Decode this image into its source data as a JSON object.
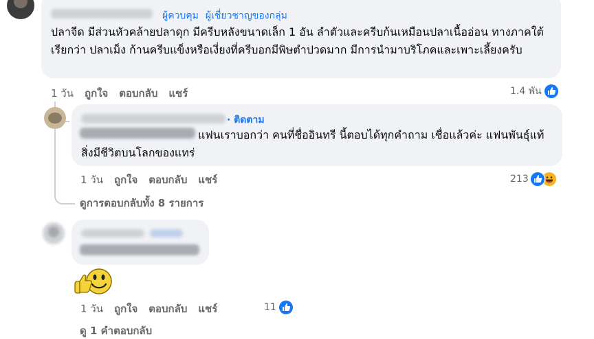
{
  "comment1": {
    "badges": [
      "ผู้ควบคุม",
      "ผู้เชี่ยวชาญของกลุ่ม"
    ],
    "text": "ปลาจีด มีส่วนหัวคล้ายปลาดุก มีครีบหลังขนาดเล็ก 1 อัน ลำตัวและครีบก้นเหมือนปลาเนื้ออ่อน ทางภาคใต้เรียกว่า ปลาเม็ง ก้านครีบแข็งหรือเงี่ยงที่ครีบอกมีพิษตำปวดมาก มีการนำมาบริโภคและเพาะเลี้ยงครับ",
    "time": "1 วัน",
    "like": "ถูกใจ",
    "reply": "ตอบกลับ",
    "share": "แชร์",
    "reaction_count": "1.4 พัน"
  },
  "comment2": {
    "follow": "· ติดตาม",
    "text": "แฟนเราบอกว่า คนที่ชื่ออินทรี นี้ตอบได้ทุกคำถาม เชื่อแล้วค่ะ แฟนพันธุ์แท้สิ่งมีชีวิตบนโลกของแทร่",
    "time": "1 วัน",
    "like": "ถูกใจ",
    "reply": "ตอบกลับ",
    "share": "แชร์",
    "reaction_count": "213"
  },
  "view_replies": "ดูการตอบกลับทั้ง 8 รายการ",
  "comment3": {
    "time": "1 วัน",
    "like": "ถูกใจ",
    "reply": "ตอบกลับ",
    "share": "แชร์",
    "reaction_count": "11"
  },
  "more_replies": "ดู 1 คำตอบกลับ",
  "colors": {
    "bubble": "#f0f2f5",
    "link": "#1877f2",
    "meta": "#65676b",
    "like": "#1877f2"
  },
  "icons": [
    "like-icon",
    "haha-icon",
    "thumbs-up-smiley-sticker"
  ]
}
